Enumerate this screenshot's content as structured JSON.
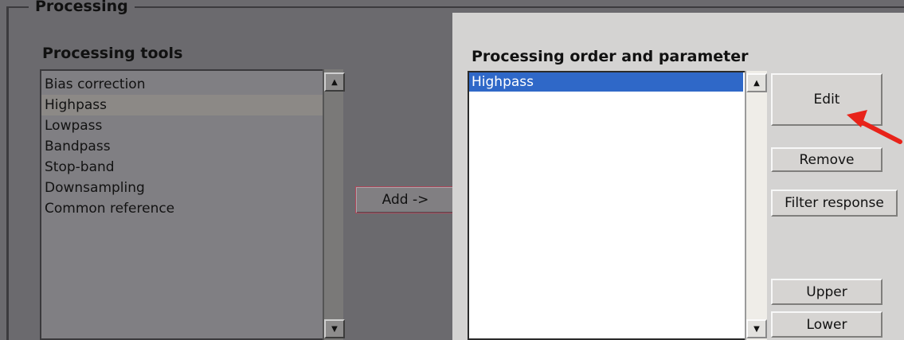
{
  "group": {
    "title": "Processing"
  },
  "tools": {
    "label": "Processing tools",
    "items": [
      "Bias correction",
      "Highpass",
      "Lowpass",
      "Bandpass",
      "Stop-band",
      "Downsampling",
      "Common reference"
    ],
    "selected_index": 1
  },
  "add_button": {
    "label": "Add ->"
  },
  "order": {
    "label": "Processing order and parameter",
    "items": [
      "Highpass"
    ],
    "selected_index": 0
  },
  "buttons": {
    "edit": "Edit",
    "remove": "Remove",
    "filter_response": "Filter response",
    "upper": "Upper",
    "lower": "Lower"
  },
  "colors": {
    "selection": "#2f68c8",
    "annotation_arrow": "#e8231a"
  }
}
